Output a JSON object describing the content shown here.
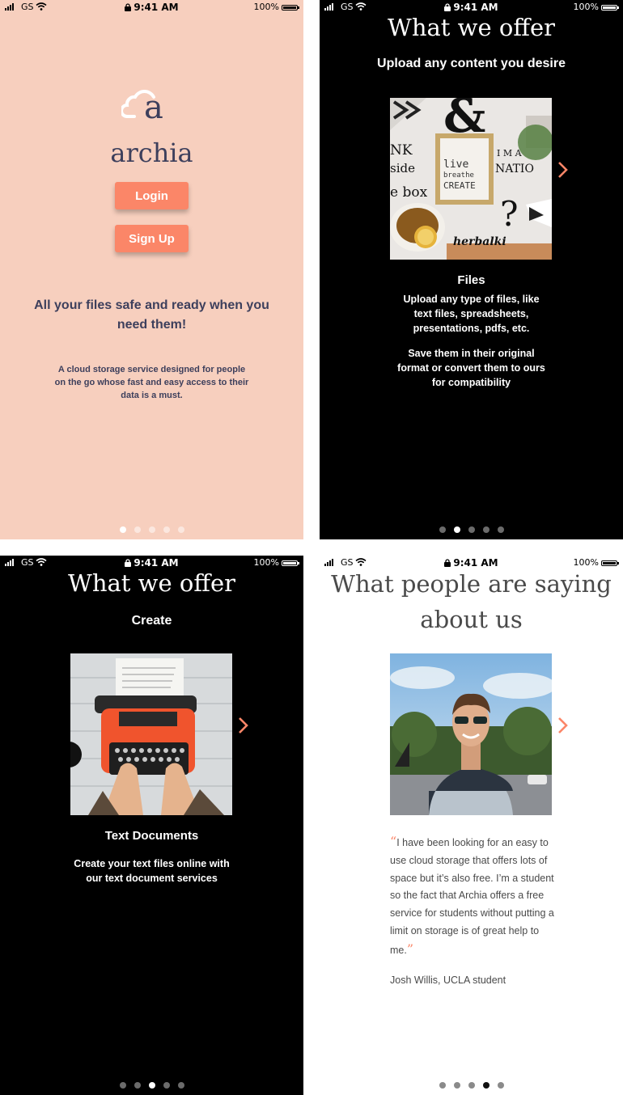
{
  "status_bar": {
    "carrier": "GS",
    "time": "9:41 AM",
    "battery": "100%"
  },
  "colors": {
    "accent": "#fb8668",
    "peach_bg": "#f7cfbe",
    "navy_text": "#3d3f5c",
    "dark_bg": "#000000"
  },
  "welcome": {
    "brand": "archia",
    "login_label": "Login",
    "signup_label": "Sign Up",
    "tagline": "All your files safe and ready when you need them!",
    "description": "A cloud storage service designed for people on the go whose fast and easy access to their data is a must.",
    "page_index": 0
  },
  "offer_files": {
    "title": "What we offer",
    "subtitle": "Upload any content you desire",
    "feature_title": "Files",
    "body_1": "Upload any type of files, like text files, spreadsheets, presentations, pdfs, etc.",
    "body_2": "Save them in their original format or convert them to ours for compatibility",
    "page_index": 1
  },
  "offer_create": {
    "title": "What we offer",
    "subtitle": "Create",
    "feature_title": "Text Documents",
    "body_1": "Create your text files online with our text document services",
    "page_index": 2
  },
  "testimonial": {
    "title_line1": "What people are saying",
    "title_line2": "about us",
    "quote_open": "“",
    "quote": "I have been looking for an easy to use cloud storage that offers lots of space but it’s also free. I’m a student so the fact that Archia offers a free service for students without putting a limit on storage is of great help to me.",
    "quote_close": "”",
    "author": "Josh Willis, UCLA student",
    "page_index": 3
  },
  "pagination": {
    "total_pages": 5
  },
  "icons": [
    "cloud-logo-icon",
    "signal-icon",
    "wifi-icon",
    "lock-icon",
    "battery-icon",
    "chevron-right-icon"
  ]
}
